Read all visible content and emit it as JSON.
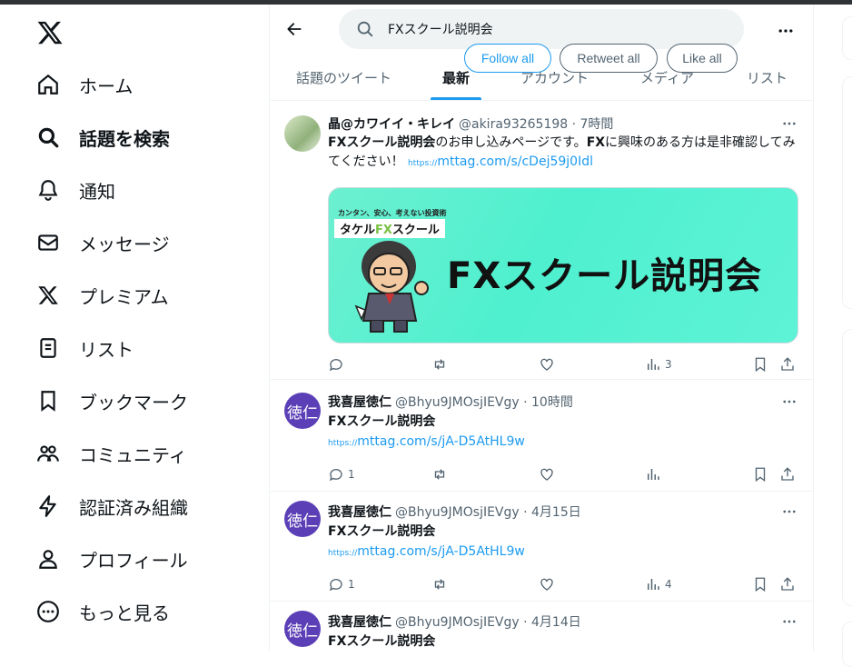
{
  "sidebar": {
    "items": [
      {
        "label": "ホーム",
        "icon": "home-icon"
      },
      {
        "label": "話題を検索",
        "icon": "search-icon",
        "active": true
      },
      {
        "label": "通知",
        "icon": "bell-icon"
      },
      {
        "label": "メッセージ",
        "icon": "mail-icon"
      },
      {
        "label": "プレミアム",
        "icon": "x-logo-icon"
      },
      {
        "label": "リスト",
        "icon": "list-icon"
      },
      {
        "label": "ブックマーク",
        "icon": "bookmark-icon"
      },
      {
        "label": "コミュニティ",
        "icon": "community-icon"
      },
      {
        "label": "認証済み組織",
        "icon": "lightning-icon"
      },
      {
        "label": "プロフィール",
        "icon": "person-icon"
      },
      {
        "label": "もっと見る",
        "icon": "more-circle-icon"
      }
    ]
  },
  "search": {
    "value": "FXスクール説明会"
  },
  "buttons": {
    "follow_all": "Follow all",
    "retweet_all": "Retweet all",
    "like_all": "Like all"
  },
  "tabs": [
    "話題のツイート",
    "最新",
    "アカウント",
    "メディア",
    "リスト"
  ],
  "tweets": [
    {
      "name": "晶@カワイイ・キレイ",
      "handle": "@akira93265198 · 7時間",
      "text_bold1": "FXスクール説明会",
      "text_part1": "のお申し込みページです。",
      "text_bold2": "FX",
      "text_part2": "に興味のある方は是非確認してみてください！",
      "link_proto": "https://",
      "link": "mttag.com/s/cDej59j0Idl",
      "media": {
        "tagline": "カンタン、安心、考えない投資術",
        "brand_pre": "タケル",
        "brand_fx": "FX",
        "brand_post": "スクール",
        "headline": "FXスクール説明会"
      },
      "replies": "",
      "views": "3"
    },
    {
      "avatar_text": "徳仁",
      "name": "我喜屋徳仁",
      "handle": "@Bhyu9JMOsjIEVgy · 10時間",
      "text": "FXスクール説明会",
      "link_proto": "https://",
      "link": "mttag.com/s/jA-D5AtHL9w",
      "replies": "1",
      "views": ""
    },
    {
      "avatar_text": "徳仁",
      "name": "我喜屋徳仁",
      "handle": "@Bhyu9JMOsjIEVgy · 4月15日",
      "text": "FXスクール説明会",
      "link_proto": "https://",
      "link": "mttag.com/s/jA-D5AtHL9w",
      "replies": "1",
      "views": "4"
    },
    {
      "avatar_text": "徳仁",
      "name": "我喜屋徳仁",
      "handle": "@Bhyu9JMOsjIEVgy · 4月14日",
      "text": "FXスクール説明会"
    }
  ],
  "colors": {
    "accent": "#1d9bf0",
    "avatar_purple": "#5b3fb6",
    "media_bg": "#4ef0cf"
  }
}
